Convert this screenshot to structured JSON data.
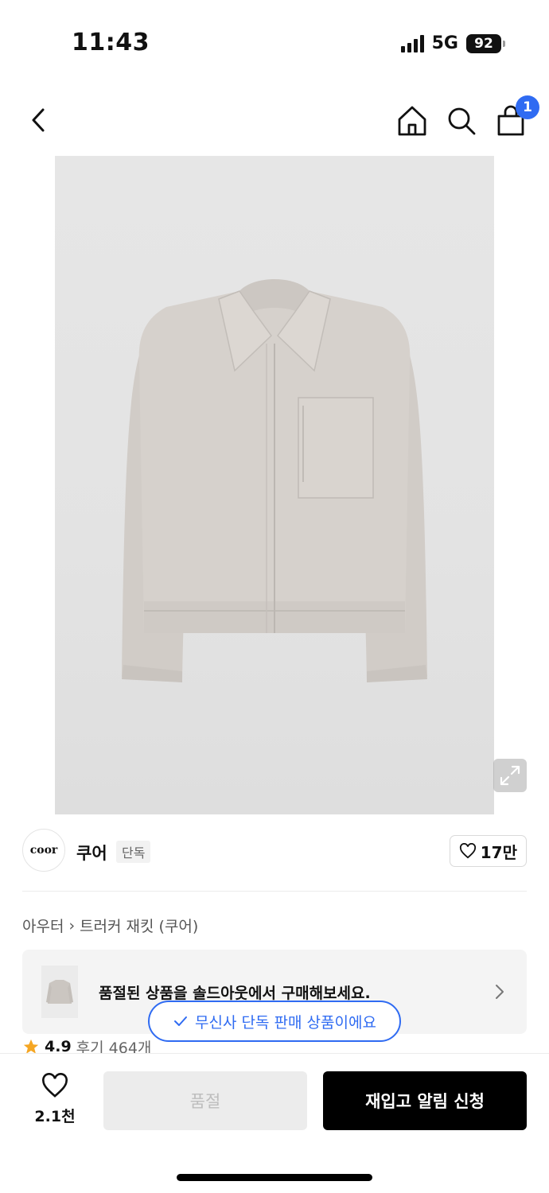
{
  "status_bar": {
    "time": "11:43",
    "network": "5G",
    "battery": "92"
  },
  "nav": {
    "cart_count": "1"
  },
  "brand": {
    "logo_text": "coor",
    "name": "쿠어",
    "tag": "단독",
    "like_count": "17만"
  },
  "breadcrumb": {
    "category": "아우터",
    "product": "트러커 재킷 (쿠어)"
  },
  "banner": {
    "text": "품절된 상품을 솔드아웃에서 구매해보세요."
  },
  "exclusive_notice": "무신사 단독 판매 상품이에요",
  "rating": {
    "score": "4.9",
    "reviews": "후기 464개"
  },
  "bottom_bar": {
    "wish_count": "2.1천",
    "soldout_label": "품절",
    "restock_label": "재입고 알림 신청"
  },
  "colors": {
    "accent_blue": "#2f6bf2",
    "jacket": "#d4cfca"
  }
}
